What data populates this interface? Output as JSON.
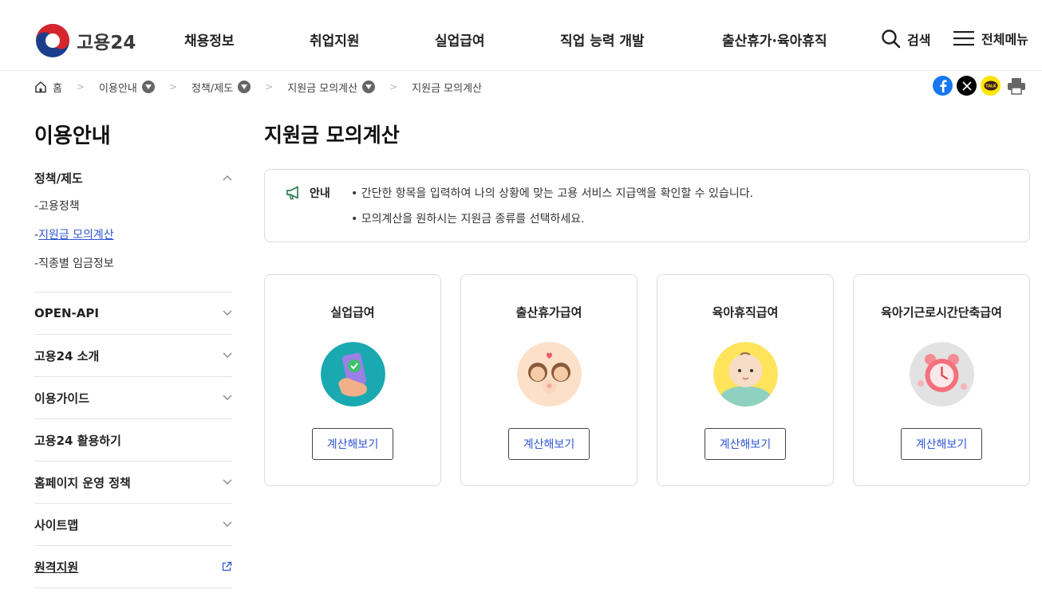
{
  "header": {
    "logo_text": "고용24",
    "nav": [
      "채용정보",
      "취업지원",
      "실업급여",
      "직업 능력 개발",
      "출산휴가·육아휴직"
    ],
    "search_label": "검색",
    "menu_label": "전체메뉴"
  },
  "breadcrumb": {
    "home": "홈",
    "items": [
      "이용안내",
      "정책/제도",
      "지원금 모의계산"
    ],
    "current": "지원금 모의계산"
  },
  "share": {
    "icons": [
      "facebook-icon",
      "x-icon",
      "kakaotalk-icon",
      "print-icon"
    ],
    "talk_text": "TALK"
  },
  "sidebar": {
    "title": "이용안내",
    "groups": [
      {
        "label": "정책/제도",
        "open": true,
        "children": [
          "고용정책",
          "지원금 모의계산",
          "직종별 임금정보"
        ]
      },
      {
        "label": "OPEN-API"
      },
      {
        "label": "고용24 소개"
      },
      {
        "label": "이용가이드"
      },
      {
        "label": "고용24 활용하기"
      },
      {
        "label": "홈페이지 운영 정책"
      },
      {
        "label": "사이트맵"
      },
      {
        "label": "원격지원"
      }
    ],
    "sub_prefix": "-"
  },
  "main": {
    "title": "지원금 모의계산",
    "notice": {
      "label": "안내",
      "lines": [
        "• 간단한 항목을 입력하여 나의 상황에 맞는 고용 서비스 지급액을 확인할 수 있습니다.",
        "• 모의계산을 원하시는 지원금 종류를 선택하세요."
      ]
    },
    "cards": [
      {
        "title": "실업급여",
        "button": "계산해보기"
      },
      {
        "title": "출산휴가급여",
        "button": "계산해보기"
      },
      {
        "title": "육아휴직급여",
        "button": "계산해보기"
      },
      {
        "title": "육아기근로시간단축급여",
        "button": "계산해보기"
      }
    ]
  },
  "colors": {
    "link_blue": "#3056d3",
    "facebook": "#1877f2",
    "kakao": "#fee500"
  }
}
